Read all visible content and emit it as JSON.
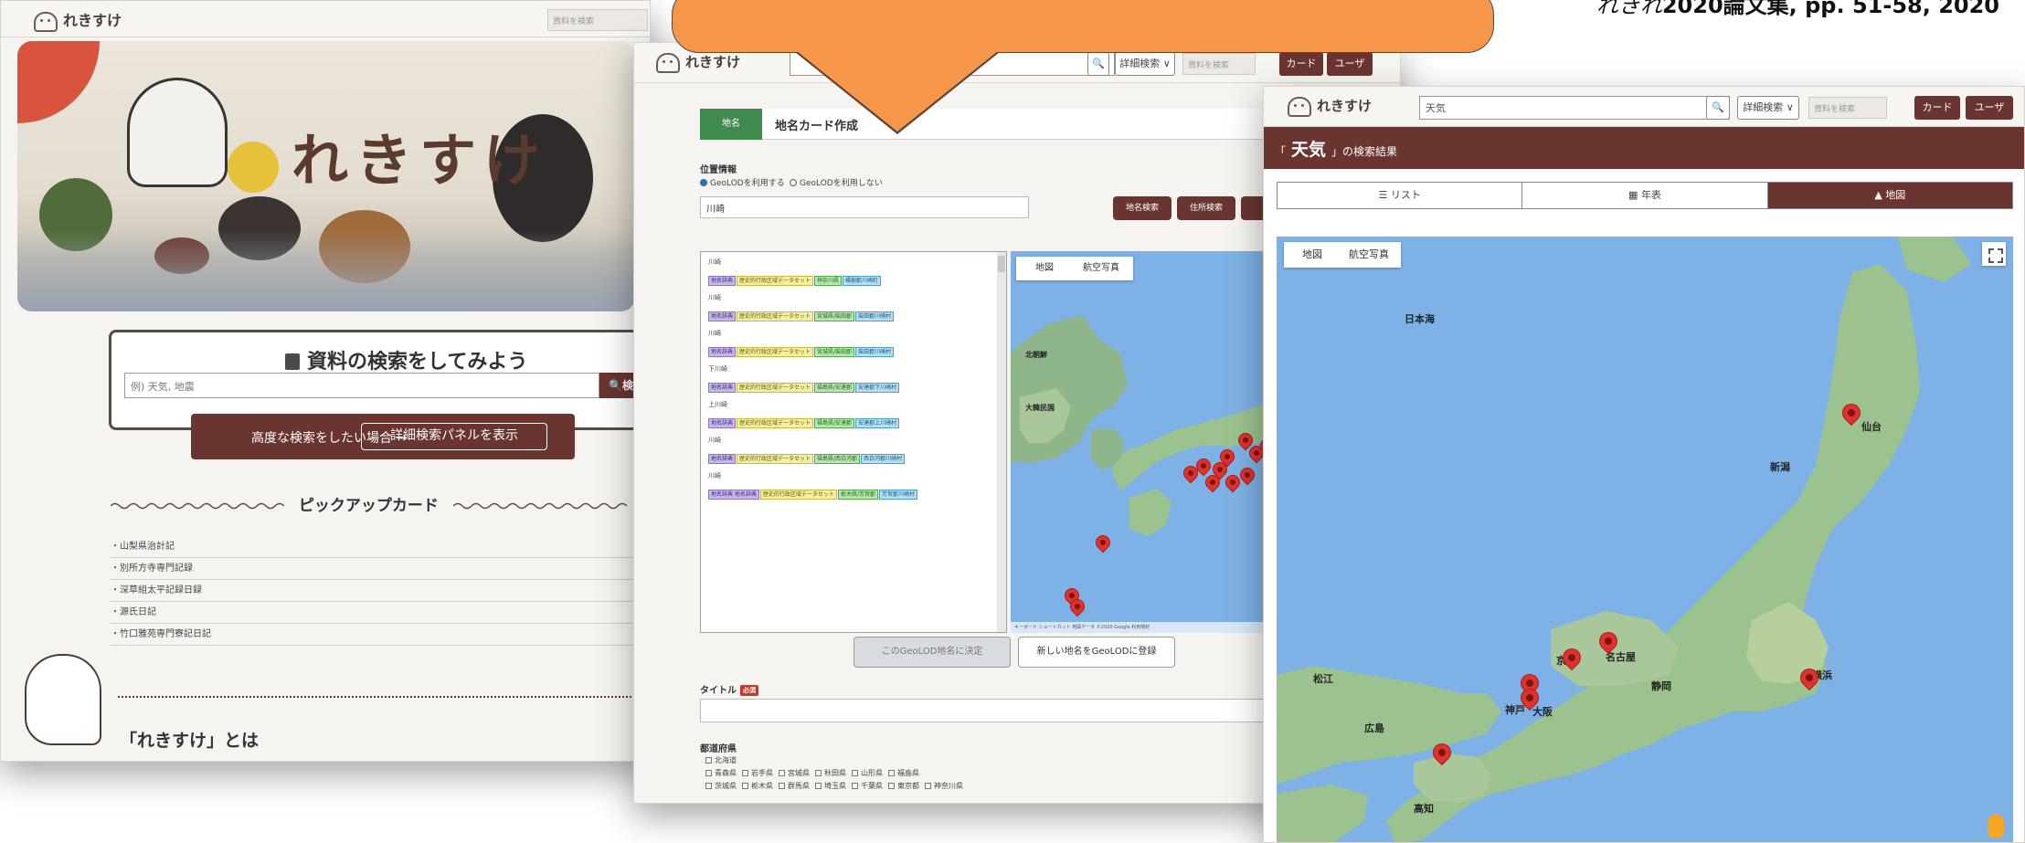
{
  "page": {
    "callout_text": "",
    "citation_italic": "れきれ",
    "citation_rest": "2020論文集, pp. 51-58, 2020"
  },
  "window1": {
    "logo": "れきすけ",
    "top_input_placeholder": "資料を検索",
    "hero_title": "れきすけ",
    "search_title": "資料の検索をしてみよう",
    "search_placeholder": "例) 天気, 地震",
    "search_button": "検索",
    "advanced_text": "高度な検索をしたい場合 →",
    "advanced_button": "詳細検索パネルを表示",
    "pickup_heading": "ピックアップカード",
    "pickup_items": [
      "山梨県治計記",
      "別所方寺専門記録",
      "深草組太平記録日録",
      "源氏日記",
      "竹口雅苑専門寮記日記"
    ],
    "about_heading": "「れきすけ」とは"
  },
  "window2": {
    "logo": "れきすけ",
    "toolbar": {
      "detail_search": "詳細検索 ∨",
      "card_button": "カード",
      "user_button": "ユーザ",
      "small_input": "資料を検索"
    },
    "card_tab_tag": "地名",
    "card_tab_title": "地名カード作成",
    "position_label": "位置情報",
    "radio_use": "GeoLODを利用する",
    "radio_nouse": "GeoLODを利用しない",
    "place_value": "川崎",
    "btn_place_search": "地名検索",
    "btn_coord_search": "住所検索",
    "groups": [
      {
        "name": "川崎",
        "tags": [
          [
            "p",
            "地名辞典"
          ],
          [
            "y",
            "歴史的行政区域データセット"
          ],
          [
            "g",
            "神奈川県"
          ],
          [
            "c",
            "橘樹郡川崎町"
          ]
        ]
      },
      {
        "name": "川崎",
        "tags": [
          [
            "p",
            "地名辞典"
          ],
          [
            "y",
            "歴史的行政区域データセット"
          ],
          [
            "g",
            "宮城県/柴田郡"
          ],
          [
            "c",
            "柴田郡川崎村"
          ]
        ]
      },
      {
        "name": "川崎",
        "tags": [
          [
            "p",
            "地名辞典"
          ],
          [
            "y",
            "歴史的行政区域データセット"
          ],
          [
            "g",
            "宮城県/柴田郡"
          ],
          [
            "c",
            "柴田郡川崎村"
          ]
        ]
      },
      {
        "name": "下川崎",
        "tags": [
          [
            "p",
            "地名辞典"
          ],
          [
            "y",
            "歴史的行政区域データセット"
          ],
          [
            "g",
            "福島県/安達郡"
          ],
          [
            "c",
            "安達郡下川崎村"
          ]
        ]
      },
      {
        "name": "上川崎",
        "tags": [
          [
            "p",
            "地名辞典"
          ],
          [
            "y",
            "歴史的行政区域データセット"
          ],
          [
            "g",
            "福島県/安達郡"
          ],
          [
            "c",
            "安達郡上川崎村"
          ]
        ]
      },
      {
        "name": "川崎",
        "tags": [
          [
            "p",
            "地名辞典"
          ],
          [
            "y",
            "歴史的行政区域データセット"
          ],
          [
            "g",
            "福島県/西白河郡"
          ],
          [
            "c",
            "西白河郡川崎村"
          ]
        ]
      },
      {
        "name": "川崎",
        "tags": [
          [
            "p",
            "地名辞典 地名辞典"
          ],
          [
            "y",
            "歴史的行政区域データセット"
          ],
          [
            "g",
            "栃木県/芳賀郡"
          ],
          [
            "c",
            "芳賀郡川崎村"
          ]
        ]
      }
    ],
    "map_tabs": [
      "地図",
      "航空写真"
    ],
    "map_labels": [
      "北朝鮮",
      "大韓民国",
      "日本"
    ],
    "map_footer": "キーボード ショートカット  地図データ ©2020 Google  利用規約",
    "btn_set_location": "このGeoLOD地名に決定",
    "btn_register": "新しい地名をGeoLODに登録",
    "title_label": "タイトル",
    "required": "必須",
    "prefecture_label": "都道府県",
    "prefecture_rows": [
      [
        "北海道"
      ],
      [
        "青森県",
        "岩手県",
        "宮城県",
        "秋田県",
        "山形県",
        "福島県"
      ],
      [
        "茨城県",
        "栃木県",
        "群馬県",
        "埼玉県",
        "千葉県",
        "東京都",
        "神奈川県"
      ]
    ]
  },
  "window3": {
    "logo": "れきすけ",
    "search_value": "天気",
    "toolbar": {
      "detail_search": "詳細検索 ∨",
      "card_button": "カード",
      "user_button": "ユーザ",
      "small_input": "資料を検索"
    },
    "result_prefix": "「",
    "result_keyword": "天気",
    "result_suffix": "」の検索結果",
    "view_tabs": [
      "リスト",
      "年表",
      "地図"
    ],
    "map_tabs": [
      "地図",
      "航空写真"
    ],
    "map_labels": [
      "日本海",
      "仙台",
      "新潟",
      "名古屋",
      "大阪",
      "横浜",
      "静岡",
      "広島",
      "高知",
      "松江",
      "京都",
      "神戸"
    ]
  }
}
